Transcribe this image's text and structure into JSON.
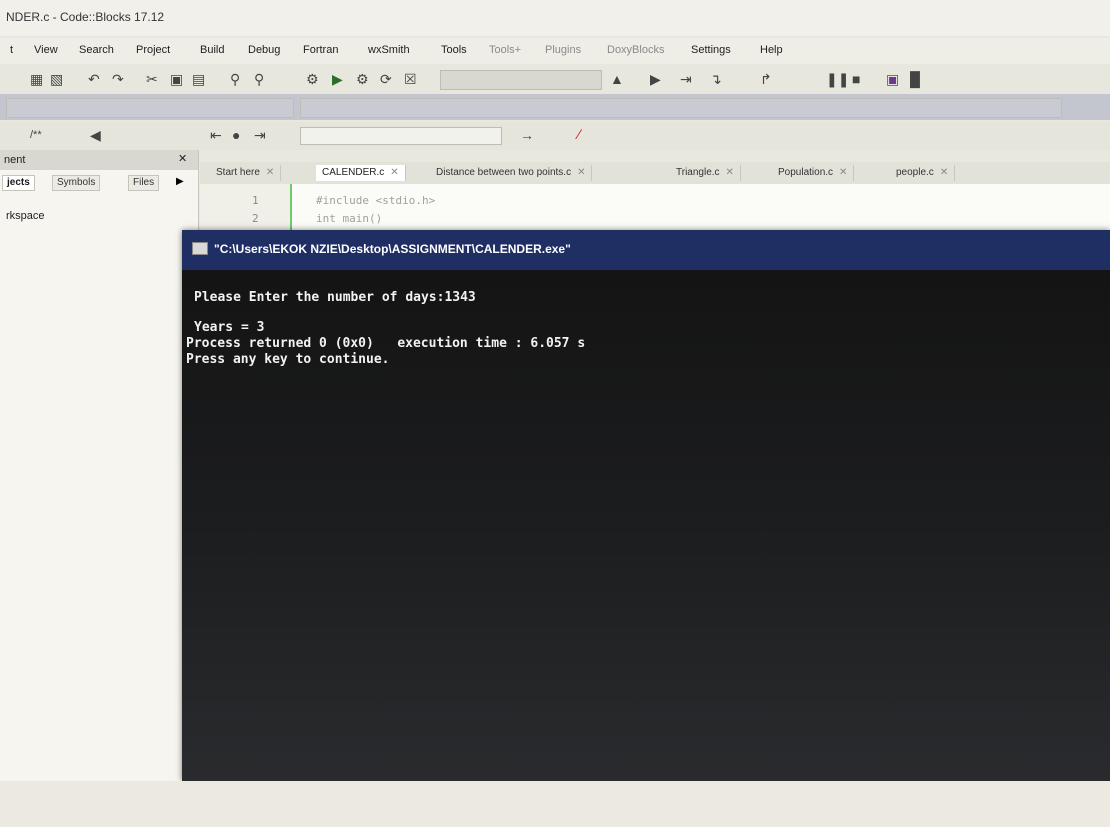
{
  "window": {
    "title": "NDER.c - Code::Blocks 17.12"
  },
  "menu": [
    "t",
    "View",
    "Search",
    "Project",
    "Build",
    "Debug",
    "Fortran",
    "wxSmith",
    "Tools",
    "Tools+",
    "Plugins",
    "DoxyBlocks",
    "Settings",
    "Help"
  ],
  "left_panel": {
    "header": "nent",
    "tabs": [
      "jects",
      "Symbols",
      "Files"
    ],
    "tree_item": "rkspace"
  },
  "editor": {
    "tabs": [
      {
        "label": "Start here",
        "active": false
      },
      {
        "label": "CALENDER.c",
        "active": true
      },
      {
        "label": "Distance between two points.c",
        "active": false
      },
      {
        "label": "Triangle.c",
        "active": false
      },
      {
        "label": "Population.c",
        "active": false
      },
      {
        "label": "people.c",
        "active": false
      }
    ],
    "lines": [
      {
        "num": "1",
        "code": "#include <stdio.h>"
      },
      {
        "num": "2",
        "code": "int main()"
      }
    ]
  },
  "console": {
    "title": "\"C:\\Users\\EKOK NZIE\\Desktop\\ASSIGNMENT\\CALENDER.exe\"",
    "lines": [
      "Please Enter the number of days:1343",
      "",
      "Years = 3",
      "Process returned 0 (0x0)   execution time : 6.057 s",
      "Press any key to continue."
    ]
  },
  "icons": {
    "toolbar": [
      "save-icon",
      "save-all-icon",
      "undo-icon",
      "redo-icon",
      "cut-icon",
      "copy-icon",
      "paste-icon",
      "find-icon",
      "replace-icon",
      "build-icon",
      "run-icon",
      "build-run-icon",
      "rebuild-icon",
      "abort-icon"
    ],
    "debug": [
      "debug-icon",
      "run-to-cursor-icon",
      "next-line-icon",
      "step-into-icon",
      "step-out-icon",
      "pause-icon",
      "stop-icon"
    ]
  }
}
